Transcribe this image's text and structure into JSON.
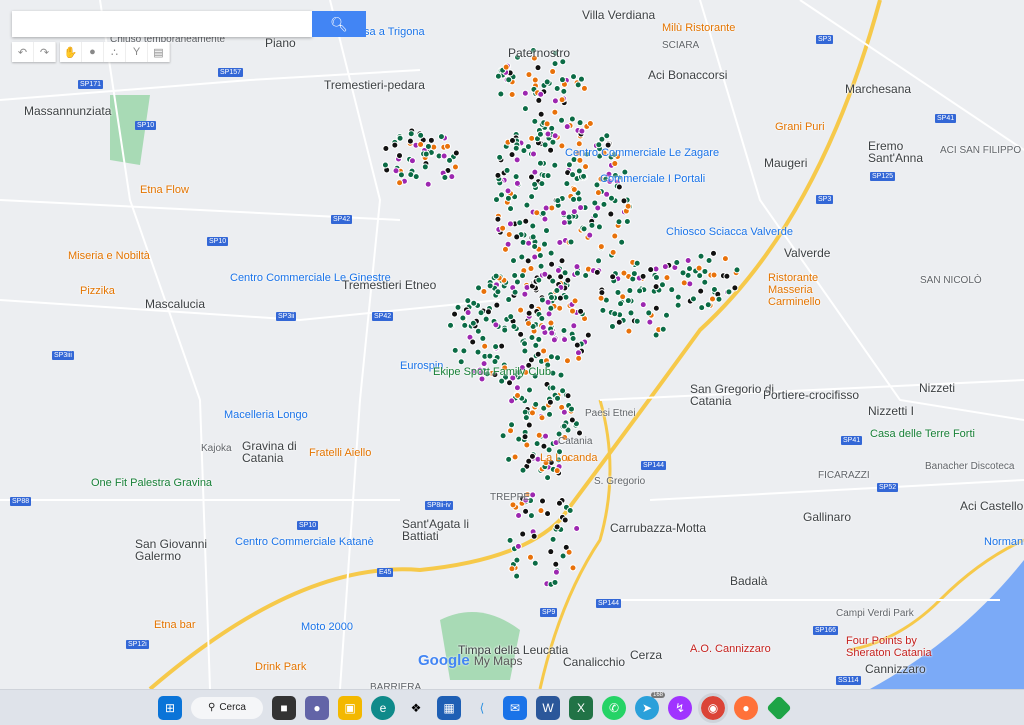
{
  "search": {
    "placeholder": "",
    "icon": "search-icon"
  },
  "toolbar": {
    "items": [
      "undo-icon",
      "redo-icon",
      "hand-icon",
      "marker-icon",
      "draw-line-icon",
      "directions-icon",
      "ruler-icon"
    ]
  },
  "map": {
    "places": [
      "Piano",
      "Paternostro",
      "Villa Verdiana",
      "Milù Ristorante",
      "SCIARA",
      "Aci Bonaccorsi",
      "Tremestieri-pedara",
      "Massannunziata",
      "Marchesana",
      "Grani Puri",
      "Eremo Sant'Anna",
      "ACI SAN FILIPPO",
      "Maugeri",
      "Centro Commerciale Le Zagare",
      "Commerciale I Portali",
      "Etna Flow",
      "Chiosco Sciacca Valverde",
      "Valverde",
      "Miseria e Nobiltà",
      "Centro Commerciale Le Ginestre",
      "Tremestieri Etneo",
      "Ristorante Masseria Carminello",
      "SAN NICOLÒ",
      "Pizzika",
      "Mascalucia",
      "Eurospin",
      "Ekipe Sport Family Club",
      "San Gregorio di Catania",
      "Portiere-crocifisso",
      "Nizzeti",
      "Nizzetti I",
      "Macelleria Longo",
      "Gravina di Catania",
      "Kajoka",
      "Casa delle Terre Forti",
      "Fratelli Aiello",
      "La Locanda",
      "Banacher Discoteca",
      "One Fit Palestra Gravina",
      "FICARAZZI",
      "Gallinaro",
      "Aci Castello",
      "Sant'Agata li Battiati",
      "Carrubazza-Motta",
      "San Giovanni Galermo",
      "Centro Commerciale Katanè",
      "Normanno-Sve",
      "Badalà",
      "Campi Verdi Park",
      "Etna bar",
      "Moto 2000",
      "Timpa della Leucatia",
      "Four Points by Sheraton Catania",
      "A.O. Cannizzaro",
      "Cannizzaro",
      "Drink Park",
      "Canalicchio",
      "Cerza",
      "BARRIERA",
      "Chiuso temporaneamente",
      "Casa a Trigona",
      "Paesi Etnei",
      "Catania",
      "S. Gregorio",
      "TREPPE"
    ],
    "roads": [
      "SP157",
      "SP171",
      "SP10",
      "SP3",
      "SP42",
      "SP41",
      "SP125",
      "SP10",
      "SP3iii",
      "SP3ii",
      "SP42",
      "SP8ii-iv",
      "SP88",
      "SP10",
      "E45",
      "SP12i",
      "SP9",
      "SP144",
      "SP166",
      "SS114",
      "SP52",
      "SP41",
      "SP144",
      "SP3"
    ],
    "logo": "Google",
    "logo_suffix": "My Maps",
    "marker_colors": {
      "green": "#0b6b45",
      "purple": "#9c27b0",
      "orange": "#e8710a",
      "black": "#111111"
    }
  },
  "taskbar": {
    "search_label": "Cerca",
    "telegram_badge": "168",
    "apps": [
      "widgets",
      "teams",
      "file-explorer",
      "edge",
      "dropbox",
      "store",
      "app-arrow",
      "mail",
      "word",
      "excel",
      "whatsapp",
      "telegram",
      "messenger",
      "chrome",
      "firefox",
      "green-app"
    ]
  }
}
